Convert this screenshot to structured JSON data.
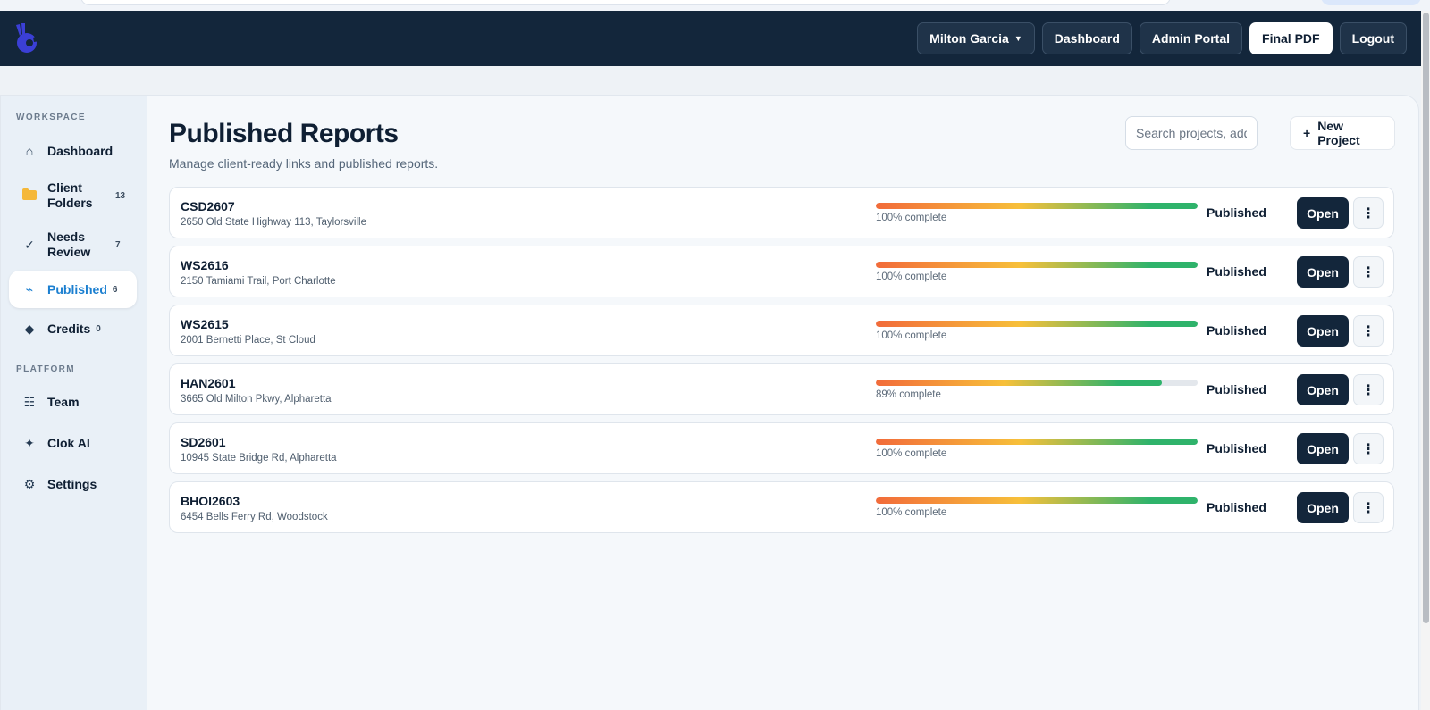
{
  "header": {
    "user_menu": "Milton Garcia",
    "buttons": [
      "Dashboard",
      "Admin Portal",
      "Final PDF",
      "Logout"
    ]
  },
  "sidebar": {
    "workspace_label": "WORKSPACE",
    "platform_label": "PLATFORM",
    "items": [
      {
        "label": "Dashboard",
        "icon": "home-icon",
        "count": ""
      },
      {
        "label": "Client Folders",
        "icon": "folder-icon",
        "count": "13"
      },
      {
        "label": "Needs Review",
        "icon": "check-icon",
        "count": "7"
      },
      {
        "label": "Published",
        "icon": "publish-icon",
        "count": "6"
      },
      {
        "label": "Credits",
        "icon": "diamond-icon",
        "count": "0"
      },
      {
        "label": "Team",
        "icon": "team-icon",
        "count": ""
      },
      {
        "label": "Clok AI",
        "icon": "sparkle-icon",
        "count": ""
      },
      {
        "label": "Settings",
        "icon": "gear-icon",
        "count": ""
      }
    ]
  },
  "main": {
    "title": "Published Reports",
    "subtitle": "Manage client-ready links and published reports.",
    "search_placeholder": "Search projects, addresses",
    "new_project_label": "New Project",
    "open_label": "Open",
    "reports": [
      {
        "code": "CSD2607",
        "address": "2650 Old State Highway 113, Taylorsville",
        "progress": 100,
        "progress_text": "100% complete",
        "status": "Published"
      },
      {
        "code": "WS2616",
        "address": "2150 Tamiami Trail, Port Charlotte",
        "progress": 100,
        "progress_text": "100% complete",
        "status": "Published"
      },
      {
        "code": "WS2615",
        "address": "2001 Bernetti Place, St Cloud",
        "progress": 100,
        "progress_text": "100% complete",
        "status": "Published"
      },
      {
        "code": "HAN2601",
        "address": "3665 Old Milton Pkwy, Alpharetta",
        "progress": 89,
        "progress_text": "89% complete",
        "status": "Published"
      },
      {
        "code": "SD2601",
        "address": "10945 State Bridge Rd, Alpharetta",
        "progress": 100,
        "progress_text": "100% complete",
        "status": "Published"
      },
      {
        "code": "BHOI2603",
        "address": "6454 Bells Ferry Rd, Woodstock",
        "progress": 100,
        "progress_text": "100% complete",
        "status": "Published"
      }
    ]
  },
  "colors": {
    "topbar": "#13263b",
    "accent": "#1b7fd0",
    "progress_start": "#f26b3a",
    "progress_mid": "#f7c03a",
    "progress_end": "#2fb36b"
  }
}
